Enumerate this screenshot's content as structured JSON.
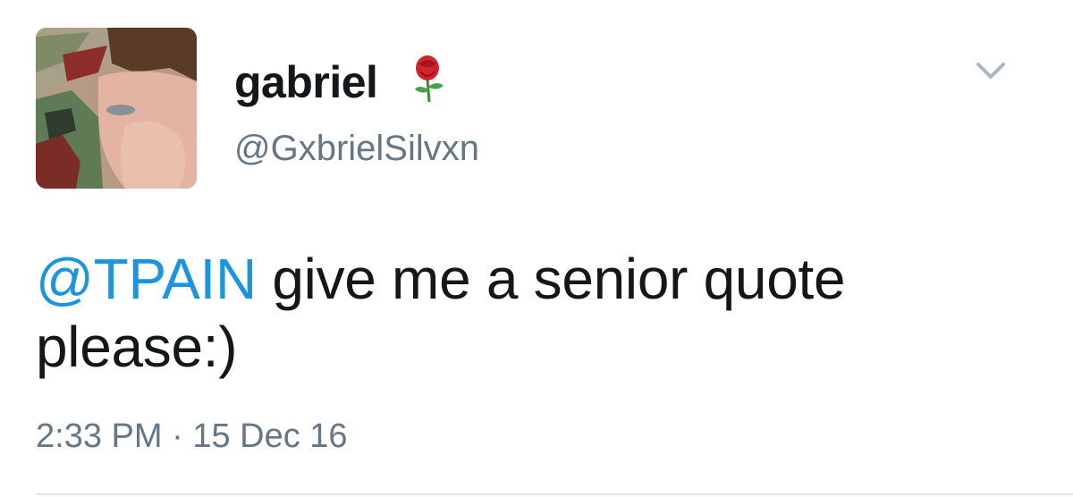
{
  "author": {
    "display_name": "gabriel",
    "handle": "@GxbrielSilvxn",
    "name_emoji": "rose-icon",
    "avatar": "profile-photo"
  },
  "tweet": {
    "mention": "@TPAIN",
    "text": " give me a senior quote please:)",
    "time": "2:33 PM",
    "separator": "·",
    "date": "15 Dec 16"
  },
  "menu": {
    "icon": "chevron-down-icon"
  },
  "colors": {
    "mention": "#1b95e0",
    "text": "#14171a",
    "muted": "#657786",
    "divider": "#e1e8ed"
  }
}
